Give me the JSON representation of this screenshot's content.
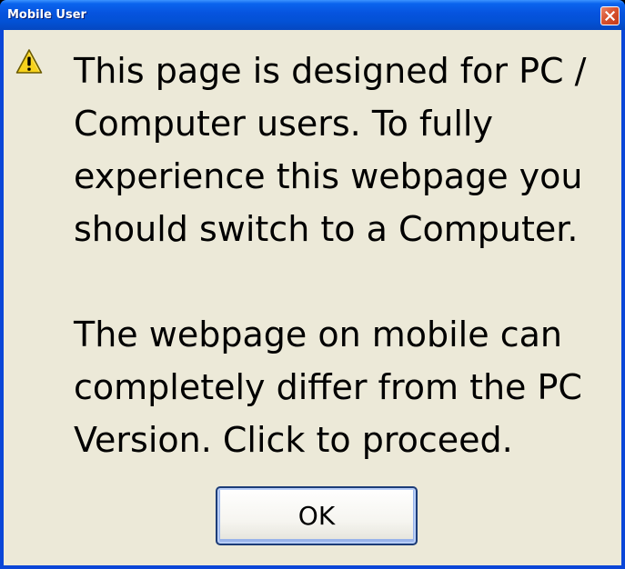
{
  "window": {
    "title": "Mobile User"
  },
  "dialog": {
    "icon": "warning-icon",
    "paragraph1": "This page is designed for PC / Computer users. To fully experience this webpage you should switch to a Computer.",
    "paragraph2": "The webpage on mobile can completely differ from the PC Version. Click to proceed.",
    "ok_label": "OK"
  },
  "colors": {
    "titlebar": "#0A5AE0",
    "client_bg": "#ECE9D8",
    "close_button": "#D8532F",
    "warning_yellow": "#F7D21C"
  }
}
